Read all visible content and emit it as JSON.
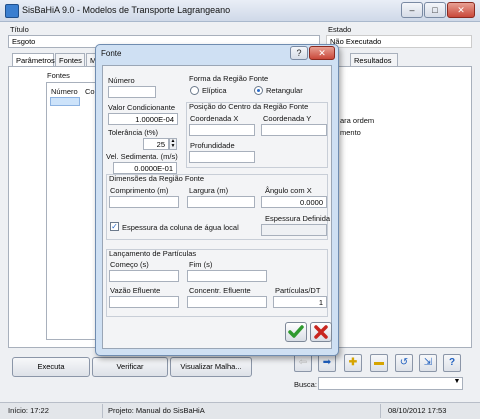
{
  "window": {
    "title": "SisBaHiA 9.0 - Modelos de Transporte Lagrangeano",
    "minimize": "–",
    "maximize": "□",
    "close": "✕"
  },
  "header": {
    "titulo_label": "Título",
    "titulo_value": "Esgoto",
    "estado_label": "Estado",
    "estado_value": "Não Executado"
  },
  "tabs": [
    "Parâmetros",
    "Fontes",
    "M",
    "Resultados"
  ],
  "fontes_panel": {
    "title": "Fontes",
    "col_numero": "Número",
    "col_co": "Co",
    "right_text_1": "ara ordem",
    "right_text_2": "mento"
  },
  "buttons": {
    "executa": "Executa",
    "verificar": "Verificar",
    "visualizar": "Visualizar Malha..."
  },
  "busca_label": "Busca:",
  "status": {
    "inicio": "Início: 17:22",
    "projeto": "Projeto: Manual do SisBaHiA",
    "datetime": "08/10/2012 17:53"
  },
  "dialog": {
    "title": "Fonte",
    "help": "?",
    "numero_label": "Número",
    "numero_value": "",
    "forma_label": "Forma da Região Fonte",
    "eliptica_label": "Elíptica",
    "retangular_label": "Retangular",
    "forma_selected": "Retangular",
    "valor_cond_label": "Valor Condicionante",
    "valor_cond_value": "1.0000E-04",
    "tolerancia_label": "Tolerância (t%)",
    "tolerancia_value": "25",
    "vel_sed_label": "Vel. Sedimenta. (m/s)",
    "vel_sed_value": "0.0000E-01",
    "posicao_label": "Posição do Centro da Região Fonte",
    "coord_x_label": "Coordenada X",
    "coord_y_label": "Coordenada Y",
    "profundidade_label": "Profundidade",
    "dimensoes_label": "Dimensões da Região Fonte",
    "comprimento_label": "Comprimento (m)",
    "largura_label": "Largura (m)",
    "angulo_label": "Ângulo com X",
    "angulo_value": "0.0000",
    "espessura_check_label": "Espessura da coluna de água local",
    "espessura_checked": true,
    "espessura_definida_label": "Espessura Definida",
    "lancamento_label": "Lançamento de Partículas",
    "comeco_label": "Começo (s)",
    "fim_label": "Fim (s)",
    "vazao_label": "Vazão Efluente",
    "concentr_label": "Concentr. Efluente",
    "particulas_label": "Partículas/DT",
    "particulas_value": "1"
  }
}
